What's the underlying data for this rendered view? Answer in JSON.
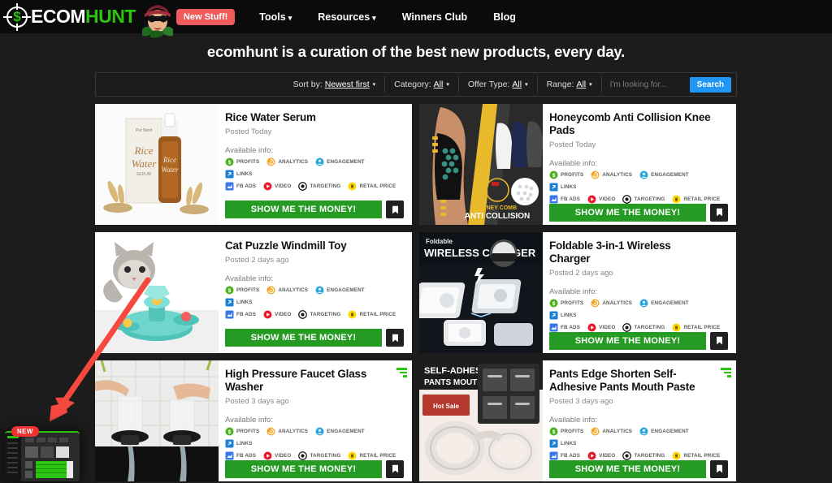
{
  "brand": {
    "logo_ecom": "ECOM",
    "logo_hunt": "HUNT",
    "logo_symbol": "$",
    "mascot_alt": "mascot-avatar"
  },
  "nav": {
    "badge": "New Stuff!",
    "items": [
      {
        "label": "Tools",
        "has_caret": true
      },
      {
        "label": "Resources",
        "has_caret": true
      },
      {
        "label": "Winners Club",
        "has_caret": false
      },
      {
        "label": "Blog",
        "has_caret": false
      }
    ],
    "caret_glyph": "▾"
  },
  "hero": {
    "title": "ecomhunt is a curation of the best new products, every day."
  },
  "filters": {
    "sort": {
      "label": "Sort by:",
      "value": "Newest first"
    },
    "category": {
      "label": "Category:",
      "value": "All"
    },
    "offer_type": {
      "label": "Offer Type:",
      "value": "All"
    },
    "range": {
      "label": "Range:",
      "value": "All"
    },
    "search": {
      "placeholder": "I'm looking for...",
      "value": "",
      "button": "Search"
    },
    "caret_glyph": "▾"
  },
  "labels": {
    "available_info": "Available info:",
    "cta": "SHOW ME THE MONEY!",
    "save_icon": "bookmark-icon",
    "trend_icon": "trending-bars-icon"
  },
  "badge_types": [
    {
      "key": "profits",
      "label": "PROFITS",
      "icon": "dollar-circle-icon",
      "color": "#4caf1f"
    },
    {
      "key": "analytics",
      "label": "ANALYTICS",
      "icon": "analytics-circle-icon",
      "color": "#f5a623"
    },
    {
      "key": "engagement",
      "label": "ENGAGEMENT",
      "icon": "engagement-circle-icon",
      "color": "#29a8dd"
    },
    {
      "key": "links",
      "label": "LINKS",
      "icon": "link-square-icon",
      "color": "#1d7fd4"
    },
    {
      "key": "fb_ads",
      "label": "FB ADS",
      "icon": "fb-ads-square-icon",
      "color": "#3b78e7"
    },
    {
      "key": "video",
      "label": "VIDEO",
      "icon": "video-play-icon",
      "color": "#e8192c"
    },
    {
      "key": "targeting",
      "label": "TARGETING",
      "icon": "target-icon",
      "color": "#111111"
    },
    {
      "key": "retail_price",
      "label": "RETAIL PRICE",
      "icon": "coin-circle-icon",
      "color": "#ffd800"
    }
  ],
  "products": [
    {
      "title": "Rice Water Serum",
      "posted": "Posted Today",
      "trending": false,
      "image": "rice-water-serum-bottle-and-box-with-wheat",
      "image_theme": "serum"
    },
    {
      "title": "Honeycomb Anti Collision Knee Pads",
      "posted": "Posted Today",
      "trending": false,
      "image": "honeycomb-knee-pad-on-leg-black-yellow",
      "image_theme": "kneepad"
    },
    {
      "title": "Cat Puzzle Windmill Toy",
      "posted": "Posted 2 days ago",
      "trending": false,
      "image": "kitten-with-teal-windmill-puzzle-toy",
      "image_theme": "cattoy"
    },
    {
      "title": "Foldable 3-in-1 Wireless Charger",
      "posted": "Posted 2 days ago",
      "trending": false,
      "image": "foldable-wireless-charger-pads",
      "image_theme": "charger"
    },
    {
      "title": "High Pressure Faucet Glass Washer",
      "posted": "Posted 3 days ago",
      "trending": true,
      "image": "hands-washing-glasses-on-faucet-rinser",
      "image_theme": "washer"
    },
    {
      "title": "Pants Edge Shorten Self-Adhesive Pants Mouth Paste",
      "posted": "Posted 3 days ago",
      "trending": true,
      "image": "self-adhesive-pants-hem-tape-package",
      "image_theme": "pants"
    }
  ],
  "widget": {
    "badge": "NEW",
    "alt": "dashboard-preview-thumbnail"
  },
  "annotation": {
    "arrow": "red-arrow-pointing-to-widget"
  },
  "colors": {
    "green": "#259b24",
    "bright_green": "#2bc40f",
    "blue": "#2196f3",
    "red": "#f03232",
    "nav_bg": "#0b0b0b",
    "page_bg": "#1c1c1c"
  }
}
